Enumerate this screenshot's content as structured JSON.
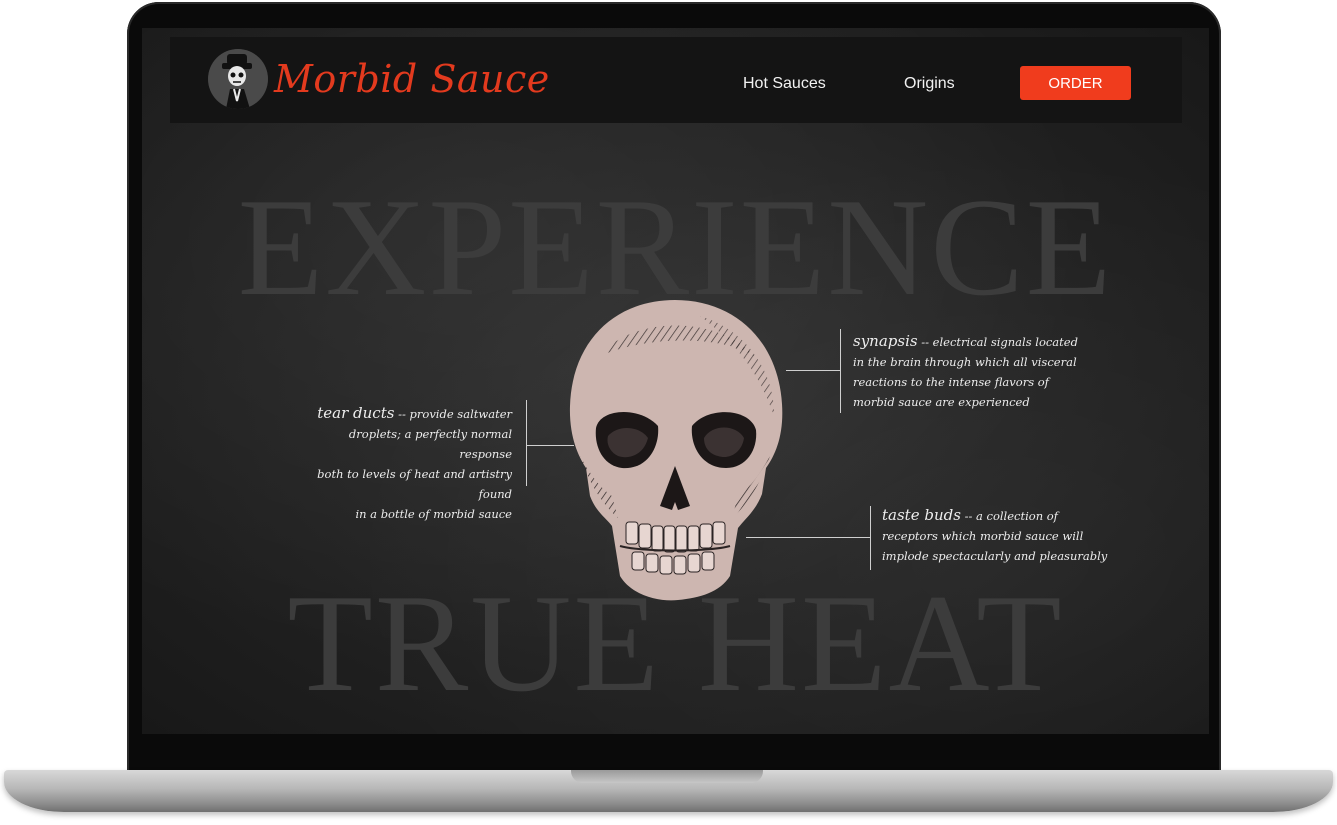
{
  "brand": {
    "name": "Morbid Sauce",
    "logo_icon": "skeleton-in-hat-icon",
    "accent_color": "#e33a1e"
  },
  "nav": {
    "links": [
      "Hot Sauces",
      "Origins"
    ],
    "order_label": "ORDER",
    "order_color": "#f03c1d"
  },
  "hero": {
    "background_words": [
      "EXPERIENCE",
      "TRUE HEAT"
    ],
    "image_icon": "skull-illustration",
    "annotations": {
      "synapsis": {
        "term": "synapsis",
        "separator": "--",
        "description_lines": [
          "electrical signals located",
          "in the brain through which all visceral",
          "reactions to the intense flavors of",
          "morbid sauce are experienced"
        ]
      },
      "tear_ducts": {
        "term": "tear ducts",
        "separator": "--",
        "description_lines": [
          "provide saltwater",
          "droplets; a perfectly normal response",
          "both to levels of heat and artistry found",
          "in a bottle of morbid sauce"
        ]
      },
      "taste_buds": {
        "term": "taste buds",
        "separator": "--",
        "description_lines": [
          "a collection of",
          "receptors which morbid sauce will",
          "implode spectacularly and pleasurably"
        ]
      }
    }
  }
}
